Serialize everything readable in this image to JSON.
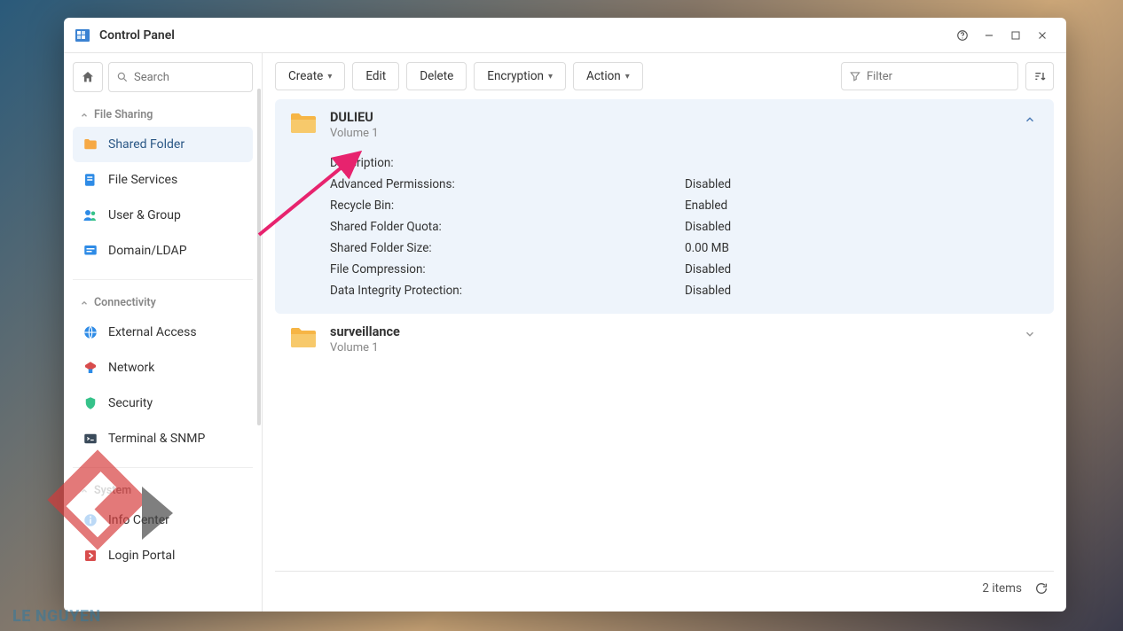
{
  "window": {
    "title": "Control Panel"
  },
  "search": {
    "placeholder": "Search"
  },
  "sidebar": {
    "groups": [
      {
        "label": "File Sharing",
        "items": [
          {
            "label": "Shared Folder",
            "icon": "folder-icon",
            "active": true
          },
          {
            "label": "File Services",
            "icon": "file-services-icon"
          },
          {
            "label": "User & Group",
            "icon": "user-group-icon"
          },
          {
            "label": "Domain/LDAP",
            "icon": "domain-ldap-icon"
          }
        ]
      },
      {
        "label": "Connectivity",
        "items": [
          {
            "label": "External Access",
            "icon": "external-access-icon"
          },
          {
            "label": "Network",
            "icon": "network-icon"
          },
          {
            "label": "Security",
            "icon": "security-icon"
          },
          {
            "label": "Terminal & SNMP",
            "icon": "terminal-icon"
          }
        ]
      },
      {
        "label": "System",
        "items": [
          {
            "label": "Info Center",
            "icon": "info-icon"
          },
          {
            "label": "Login Portal",
            "icon": "login-portal-icon"
          }
        ]
      }
    ]
  },
  "toolbar": {
    "create": "Create",
    "edit": "Edit",
    "delete": "Delete",
    "encryption": "Encryption",
    "action": "Action",
    "filter_placeholder": "Filter"
  },
  "folders": [
    {
      "name": "DULIEU",
      "volume": "Volume 1",
      "expanded": true,
      "props": [
        {
          "k": "Description:",
          "v": ""
        },
        {
          "k": "Advanced Permissions:",
          "v": "Disabled"
        },
        {
          "k": "Recycle Bin:",
          "v": "Enabled"
        },
        {
          "k": "Shared Folder Quota:",
          "v": "Disabled"
        },
        {
          "k": "Shared Folder Size:",
          "v": "0.00 MB"
        },
        {
          "k": "File Compression:",
          "v": "Disabled"
        },
        {
          "k": "Data Integrity Protection:",
          "v": "Disabled"
        }
      ]
    },
    {
      "name": "surveillance",
      "volume": "Volume 1",
      "expanded": false
    }
  ],
  "footer": {
    "count": "2 items"
  },
  "watermark": "LE NGUYEN"
}
